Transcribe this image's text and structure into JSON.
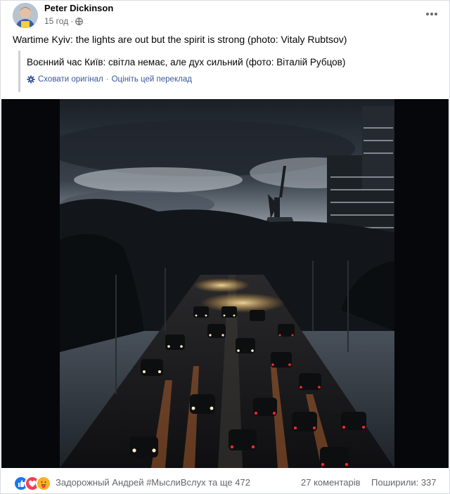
{
  "post": {
    "author": "Peter Dickinson",
    "time": "15 год",
    "privacy_icon": "globe-icon",
    "text": "Wartime Kyiv: the lights are out but the spirit is strong (photo: Vitaly Rubtsov)",
    "translation": {
      "text": "Воєнний час Київ: світла немає, але дух сильний (фото: Віталій Рубцов)",
      "show_original": "Сховати оригінал",
      "separator": "·",
      "rate_translation": "Оцініть цей переклад"
    },
    "photo": {
      "subject": "Kyiv evening traffic with Motherland Monument"
    },
    "footer": {
      "reactions": [
        "like",
        "love",
        "care"
      ],
      "reactors": "Задорожный Андрей #МыслиВслух та ще 472",
      "comments": "27 коментарів",
      "shares": "Поширили: 337"
    }
  },
  "colors": {
    "text": "#050505",
    "secondary": "#65676b",
    "link": "#385898",
    "like": "#1877f2",
    "love": "#f33e58",
    "care": "#f7b125"
  }
}
